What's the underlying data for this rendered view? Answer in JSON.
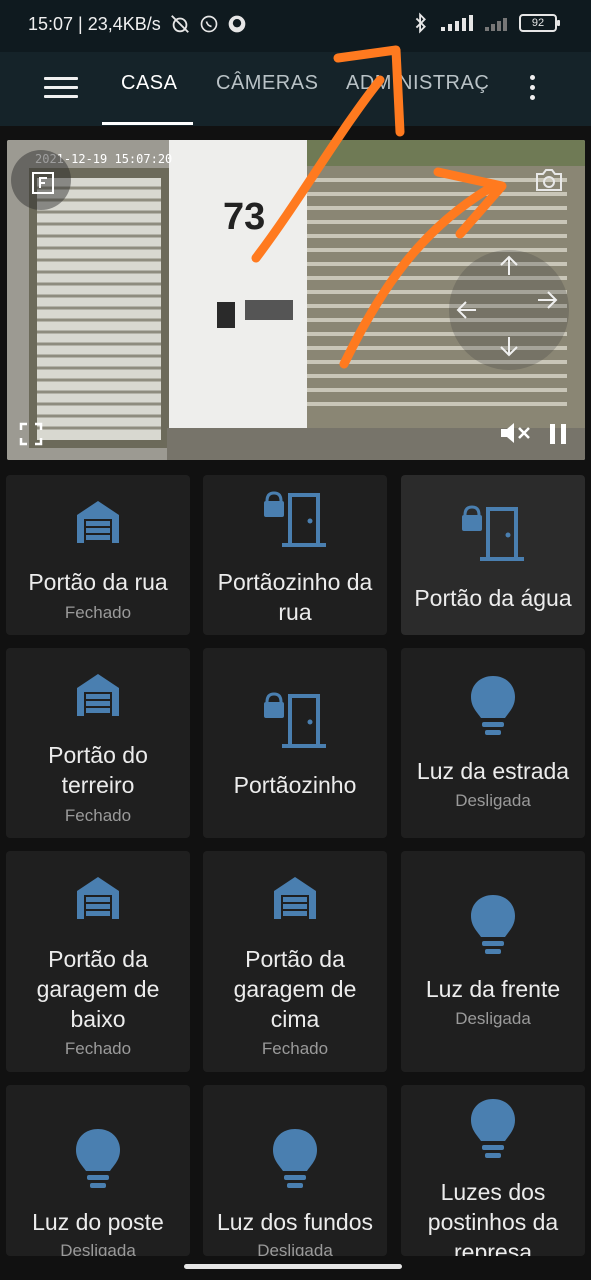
{
  "status_bar": {
    "time_speed": "15:07 | 23,4KB/s",
    "battery": "92",
    "icons": [
      "alarm-off-icon",
      "whatsapp-icon",
      "github-icon",
      "bluetooth-icon",
      "signal-icon",
      "signal-weak-icon",
      "battery-icon"
    ]
  },
  "app_bar": {
    "tabs": [
      {
        "label": "CASA",
        "active": true
      },
      {
        "label": "CÂMERAS",
        "active": false
      },
      {
        "label": "ADMINISTRAÇ",
        "active": false
      }
    ]
  },
  "camera": {
    "timestamp": "2021-12-19 15:07:20",
    "house_number": "73"
  },
  "tiles": [
    {
      "name": "Portão da rua",
      "state": "Fechado",
      "icon": "garage-icon"
    },
    {
      "name": "Portãozinho da rua",
      "state": "",
      "icon": "door-lock-icon"
    },
    {
      "name": "Portão da água",
      "state": "",
      "icon": "door-lock-icon"
    },
    {
      "name": "Portão do terreiro",
      "state": "Fechado",
      "icon": "garage-icon"
    },
    {
      "name": "Portãozinho",
      "state": "",
      "icon": "door-lock-icon"
    },
    {
      "name": "Luz da estrada",
      "state": "Desligada",
      "icon": "bulb-icon"
    },
    {
      "name": "Portão da garagem de baixo",
      "state": "Fechado",
      "icon": "garage-icon"
    },
    {
      "name": "Portão da garagem de cima",
      "state": "Fechado",
      "icon": "garage-icon"
    },
    {
      "name": "Luz da frente",
      "state": "Desligada",
      "icon": "bulb-icon"
    },
    {
      "name": "Luz do poste",
      "state": "Desligada",
      "icon": "bulb-icon"
    },
    {
      "name": "Luz dos fundos",
      "state": "Desligada",
      "icon": "bulb-icon"
    },
    {
      "name": "Luzes dos postinhos da represa",
      "state": "",
      "icon": "bulb-icon"
    }
  ],
  "colors": {
    "icon_blue": "#4a7fb0",
    "annotation_orange": "#ff7a1f",
    "tile_bg": "#1f1f1f"
  }
}
